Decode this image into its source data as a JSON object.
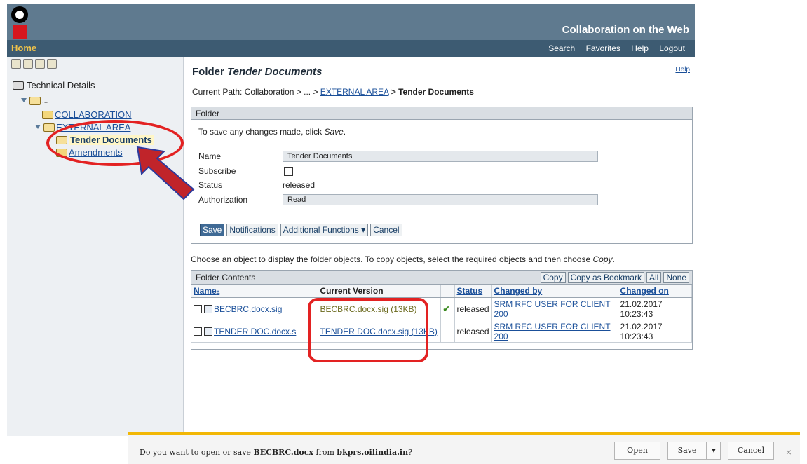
{
  "header": {
    "brand": "Collaboration on the Web"
  },
  "nav": {
    "home": "Home",
    "links": [
      "Search",
      "Favorites",
      "Help",
      "Logout"
    ]
  },
  "sidebar": {
    "root": "Technical Details",
    "ellipsis": "...",
    "items": [
      "COLLABORATION",
      "EXTERNAL AREA",
      "Tender Documents",
      "Amendments"
    ]
  },
  "main": {
    "title_prefix": "Folder",
    "title_name": "Tender Documents",
    "help": "Help",
    "path_label": "Current Path:",
    "path_root": "Collaboration > ... >",
    "path_link": "EXTERNAL AREA",
    "path_current": "> Tender Documents"
  },
  "folder_form": {
    "section": "Folder",
    "hint_prefix": "To save any changes made, click",
    "hint_action": "Save",
    "name_label": "Name",
    "name_value": "Tender Documents",
    "subscribe_label": "Subscribe",
    "status_label": "Status",
    "status_value": "released",
    "auth_label": "Authorization",
    "auth_value": "Read",
    "buttons": [
      "Save",
      "Notifications",
      "Additional Functions",
      "Cancel"
    ]
  },
  "instruction": {
    "text": "Choose an object to display the folder objects. To copy objects, select the required objects and then choose",
    "action": "Copy"
  },
  "contents": {
    "title": "Folder Contents",
    "actions": [
      "Copy",
      "Copy as Bookmark",
      "All",
      "None"
    ],
    "columns": [
      "Name",
      "Current Version",
      "Status",
      "Changed by",
      "Changed on"
    ],
    "rows": [
      {
        "name": "BECBRC.docx.sig",
        "version": "BECBRC.docx.sig (13KB)",
        "status": "released",
        "changed_by": "SRM RFC USER FOR CLIENT 200",
        "changed_on": "21.02.2017 10:23:43"
      },
      {
        "name": "TENDER DOC.docx.s",
        "version": "TENDER DOC.docx.sig (13KB)",
        "status": "released",
        "changed_by": "SRM RFC USER FOR CLIENT 200",
        "changed_on": "21.02.2017 10:23:43"
      }
    ]
  },
  "download": {
    "prefix": "Do you want to open or save",
    "file": "BECBRC.docx",
    "from": "from",
    "site": "bkprs.oilindia.in",
    "suffix": "?",
    "open": "Open",
    "save": "Save",
    "cancel": "Cancel",
    "close": "×"
  },
  "colors": {
    "header": "#5f7a8f",
    "nav": "#3d5b72",
    "accent_yellow": "#f2b705",
    "annotation_red": "#e32222"
  }
}
